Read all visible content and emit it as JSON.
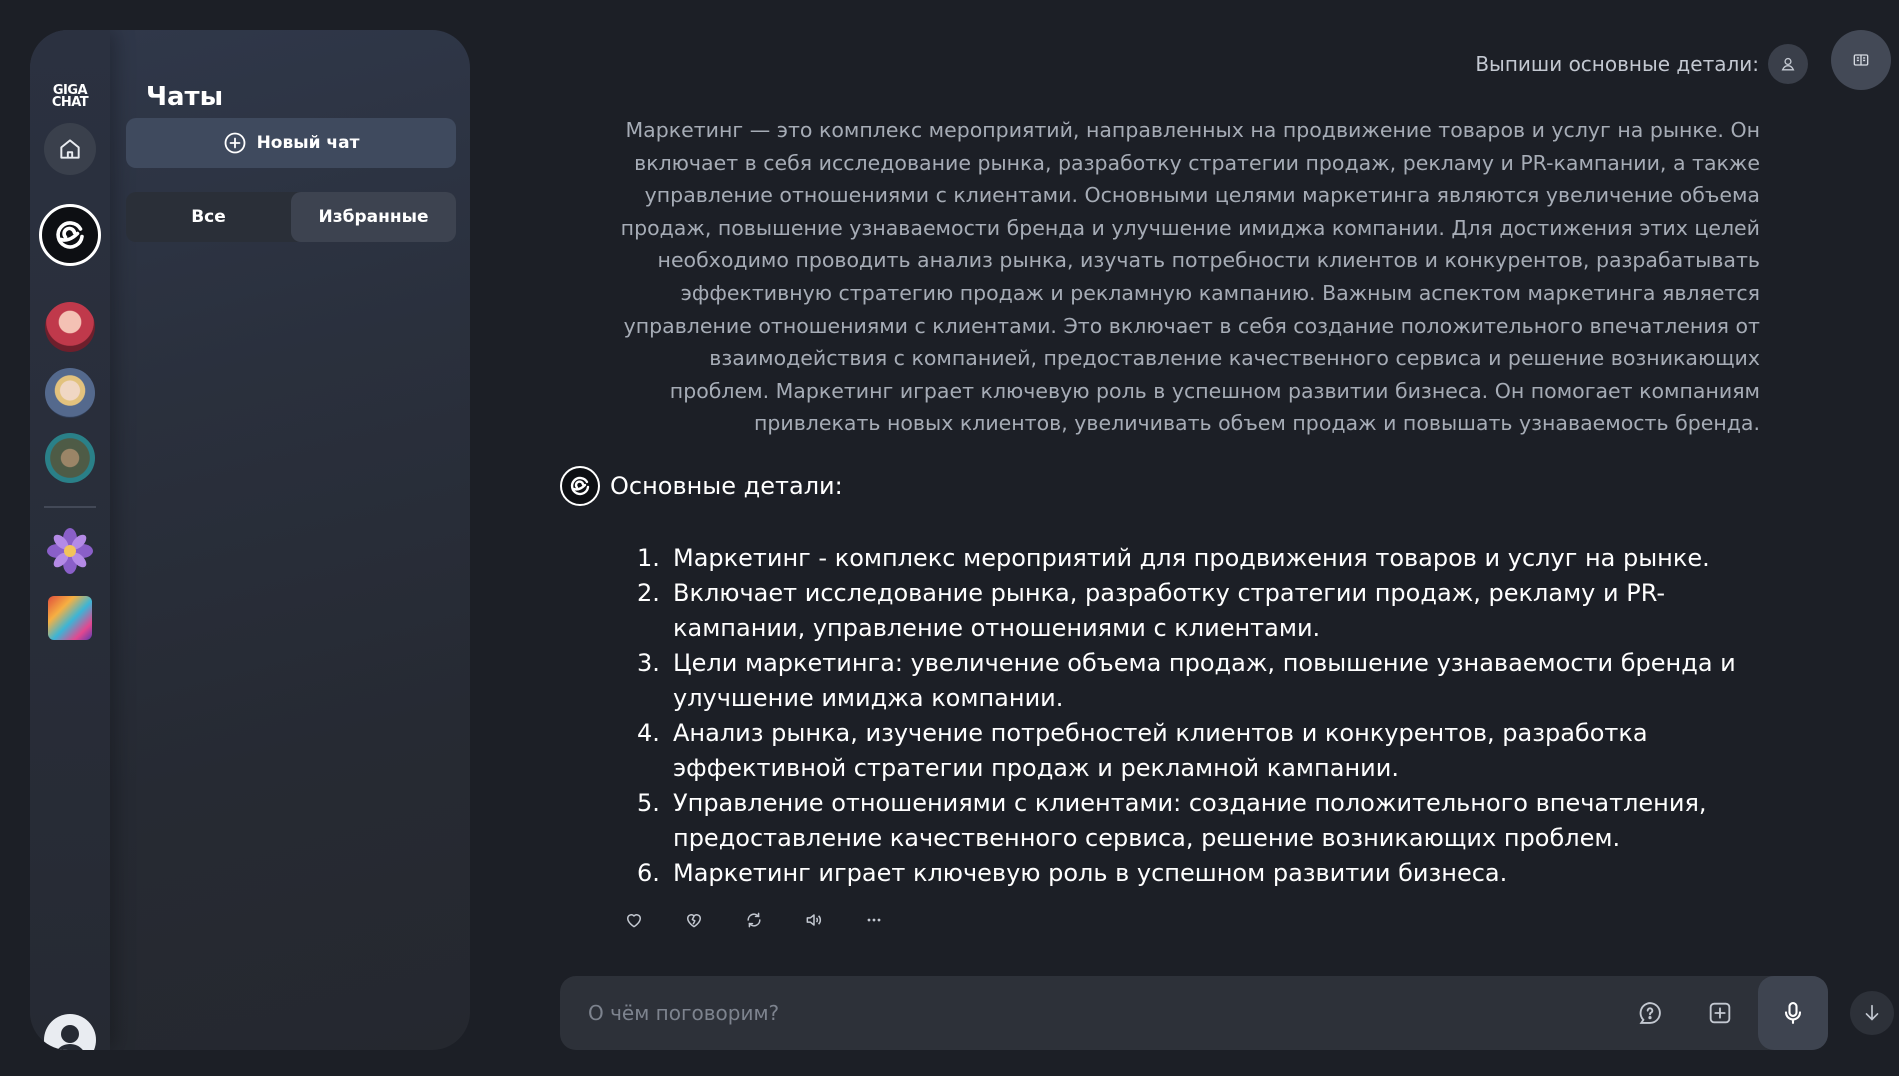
{
  "app": {
    "logo_line1": "GIGA",
    "logo_line2": "CHAT"
  },
  "sidebar": {
    "title": "Чаты",
    "new_chat_label": "Новый чат",
    "filters": [
      "Все",
      "Избранные"
    ],
    "active_filter": "Избранные"
  },
  "conversation": {
    "prompt_label": "Выпиши основные детали:",
    "user_message": "Маркетинг — это комплекс мероприятий, направленных на продвижение товаров и услуг на рынке. Он включает в себя исследование рынка, разработку стратегии продаж, рекламу и PR-кампании, а также управление отношениями с клиентами. Основными целями маркетинга являются увеличение объема продаж, повышение узнаваемости бренда и улучшение имиджа компании. Для достижения этих целей необходимо проводить анализ рынка, изучать потребности клиентов и конкурентов, разрабатывать эффективную стратегию продаж и рекламную кампанию. Важным аспектом маркетинга является управление отношениями с клиентами. Это включает в себя создание положительного впечатления от взаимодействия с компанией, предоставление качественного сервиса и решение возникающих проблем. Маркетинг играет ключевую роль в успешном развитии бизнеса. Он помогает компаниям привлекать новых клиентов, увеличивать объем продаж и повышать узнаваемость бренда.",
    "answer_title": "Основные детали:",
    "answer_items": [
      {
        "num": "1.",
        "text": "Маркетинг - комплекс мероприятий для продвижения товаров и услуг на рынке."
      },
      {
        "num": "2.",
        "text": "Включает исследование рынка, разработку стратегии продаж, рекламу и PR-кампании, управление отношениями с клиентами."
      },
      {
        "num": "3.",
        "text": "Цели маркетинга: увеличение объема продаж, повышение узнаваемости бренда и улучшение имиджа компании."
      },
      {
        "num": "4.",
        "text": "Анализ рынка, изучение потребностей клиентов и конкурентов, разработка эффективной стратегии продаж и рекламной кампании."
      },
      {
        "num": "5.",
        "text": "Управление отношениями с клиентами: создание положительного впечатления, предоставление качественного сервиса, решение возникающих проблем."
      },
      {
        "num": "6.",
        "text": "Маркетинг играет ключевую роль в успешном развитии бизнеса."
      }
    ]
  },
  "input": {
    "placeholder": "О чём поговорим?"
  },
  "colors": {
    "background": "#1c1f26",
    "panel": "#2a303d",
    "accent_button": "#3f4a5e"
  }
}
